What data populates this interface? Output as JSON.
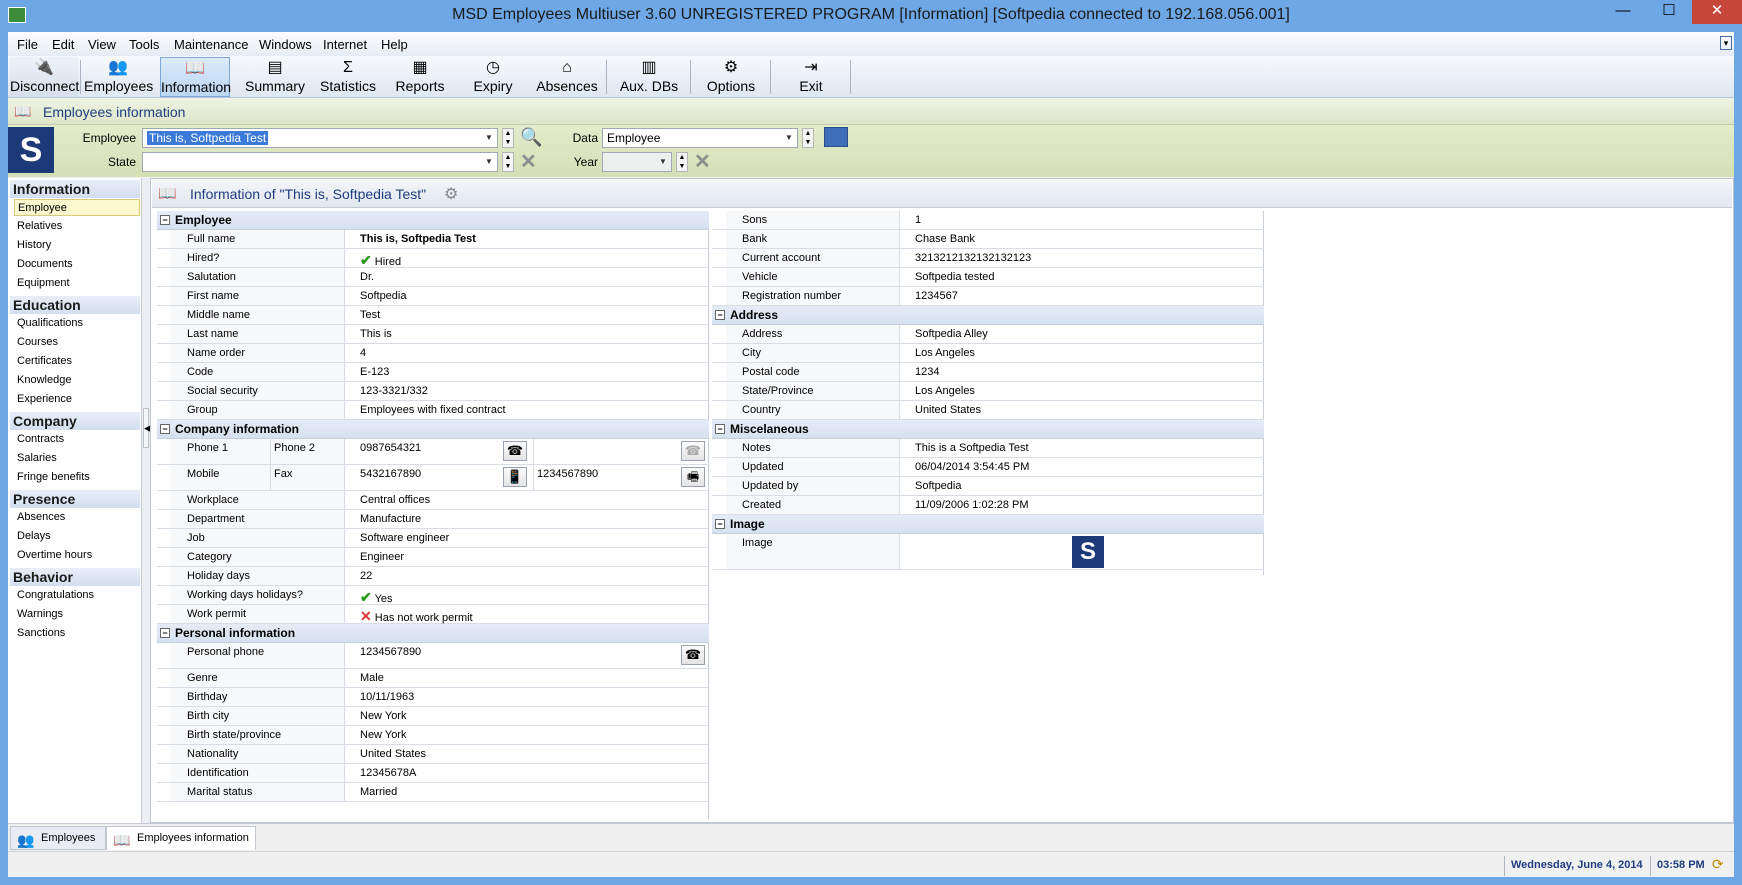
{
  "window": {
    "title": "MSD Employees Multiuser 3.60 UNREGISTERED PROGRAM [Information] [Softpedia connected to 192.168.056.001]",
    "min": "—",
    "max": "☐",
    "close": "✕"
  },
  "menu": [
    "File",
    "Edit",
    "View",
    "Tools",
    "Maintenance",
    "Windows",
    "Internet",
    "Help"
  ],
  "toolbar": [
    {
      "label": "Disconnect",
      "icon": "disconnect-icon",
      "glyph": "🔌"
    },
    {
      "label": "Employees",
      "icon": "employees-icon",
      "glyph": "👥"
    },
    {
      "label": "Information",
      "icon": "information-icon",
      "glyph": "📖"
    },
    {
      "label": "Summary",
      "icon": "summary-icon",
      "glyph": "▤"
    },
    {
      "label": "Statistics",
      "icon": "statistics-icon",
      "glyph": "Σ"
    },
    {
      "label": "Reports",
      "icon": "reports-icon",
      "glyph": "▦"
    },
    {
      "label": "Expiry",
      "icon": "clock-icon",
      "glyph": "◷"
    },
    {
      "label": "Absences",
      "icon": "house-icon",
      "glyph": "⌂"
    },
    {
      "label": "Aux. DBs",
      "icon": "database-icon",
      "glyph": "▥"
    },
    {
      "label": "Options",
      "icon": "gears-icon",
      "glyph": "⚙"
    },
    {
      "label": "Exit",
      "icon": "exit-icon",
      "glyph": "⇥"
    }
  ],
  "panel": {
    "title": "Employees information"
  },
  "filters": {
    "employee_label": "Employee",
    "employee_value": "This is, Softpedia Test",
    "data_label": "Data",
    "data_value": "Employee",
    "state_label": "State",
    "state_value": "",
    "year_label": "Year",
    "year_value": "",
    "logo_letter": "S"
  },
  "sidebar": {
    "groups": [
      {
        "title": "Information",
        "items": [
          "Employee",
          "Relatives",
          "History",
          "Documents",
          "Equipment"
        ]
      },
      {
        "title": "Education",
        "items": [
          "Qualifications",
          "Courses",
          "Certificates",
          "Knowledge",
          "Experience"
        ]
      },
      {
        "title": "Company",
        "items": [
          "Contracts",
          "Salaries",
          "Fringe benefits"
        ]
      },
      {
        "title": "Presence",
        "items": [
          "Absences",
          "Delays",
          "Overtime hours"
        ]
      },
      {
        "title": "Behavior",
        "items": [
          "Congratulations",
          "Warnings",
          "Sanctions"
        ]
      }
    ],
    "selected": "Employee"
  },
  "info": {
    "title": "Information of \"This is, Softpedia Test\"",
    "left": {
      "employee_cat": "Employee",
      "employee_rows": [
        [
          "Full name",
          "This is, Softpedia Test"
        ],
        [
          "Hired?",
          "Hired"
        ],
        [
          "Salutation",
          "Dr."
        ],
        [
          "First name",
          "Softpedia"
        ],
        [
          "Middle name",
          "Test"
        ],
        [
          "Last name",
          "This is"
        ],
        [
          "Name order",
          "4"
        ],
        [
          "Code",
          "E-123"
        ],
        [
          "Social security",
          "123-3321/332"
        ],
        [
          "Group",
          "Employees with fixed contract"
        ]
      ],
      "company_cat": "Company information",
      "phone1_label": "Phone 1",
      "phone2_label": "Phone 2",
      "phone1_value": "0987654321",
      "phone2_value": "",
      "mobile_label": "Mobile",
      "fax_label": "Fax",
      "mobile_value": "5432167890",
      "fax_value": "1234567890",
      "company_rows": [
        [
          "Workplace",
          "Central offices"
        ],
        [
          "Department",
          "Manufacture"
        ],
        [
          "Job",
          "Software engineer"
        ],
        [
          "Category",
          "Engineer"
        ],
        [
          "Holiday days",
          "22"
        ],
        [
          "Working days holidays?",
          "Yes"
        ],
        [
          "Work permit",
          "Has not work permit"
        ]
      ],
      "personal_cat": "Personal information",
      "personal_phone_label": "Personal phone",
      "personal_phone_value": "1234567890",
      "personal_rows": [
        [
          "Genre",
          "Male"
        ],
        [
          "Birthday",
          "10/11/1963"
        ],
        [
          "Birth city",
          "New York"
        ],
        [
          "Birth state/province",
          "New York"
        ],
        [
          "Nationality",
          "United States"
        ],
        [
          "Identification",
          "12345678A"
        ],
        [
          "Marital status",
          "Married"
        ]
      ]
    },
    "right": {
      "top_rows": [
        [
          "Sons",
          "1"
        ],
        [
          "Bank",
          "Chase Bank"
        ],
        [
          "Current account",
          "3213212132132132123"
        ],
        [
          "Vehicle",
          "Softpedia tested"
        ],
        [
          "Registration number",
          "1234567"
        ]
      ],
      "address_cat": "Address",
      "address_rows": [
        [
          "Address",
          "Softpedia Alley"
        ],
        [
          "City",
          "Los Angeles"
        ],
        [
          "Postal code",
          "1234"
        ],
        [
          "State/Province",
          "Los Angeles"
        ],
        [
          "Country",
          "United States"
        ]
      ],
      "misc_cat": "Miscelaneous",
      "misc_rows": [
        [
          "Notes",
          "This is a Softpedia Test"
        ],
        [
          "Updated",
          "06/04/2014 3:54:45 PM"
        ],
        [
          "Updated by",
          "Softpedia"
        ],
        [
          "Created",
          "11/09/2006 1:02:28 PM"
        ]
      ],
      "image_cat": "Image",
      "image_label": "Image",
      "image_letter": "S"
    }
  },
  "tabs": [
    "Employees",
    "Employees information"
  ],
  "status": {
    "date": "Wednesday, June 4, 2014",
    "time": "03:58 PM"
  },
  "colors": {
    "accent": "#1f3d80",
    "logo": "#1d3a78",
    "ok": "#2a9a1a",
    "bad": "#dd3333"
  }
}
